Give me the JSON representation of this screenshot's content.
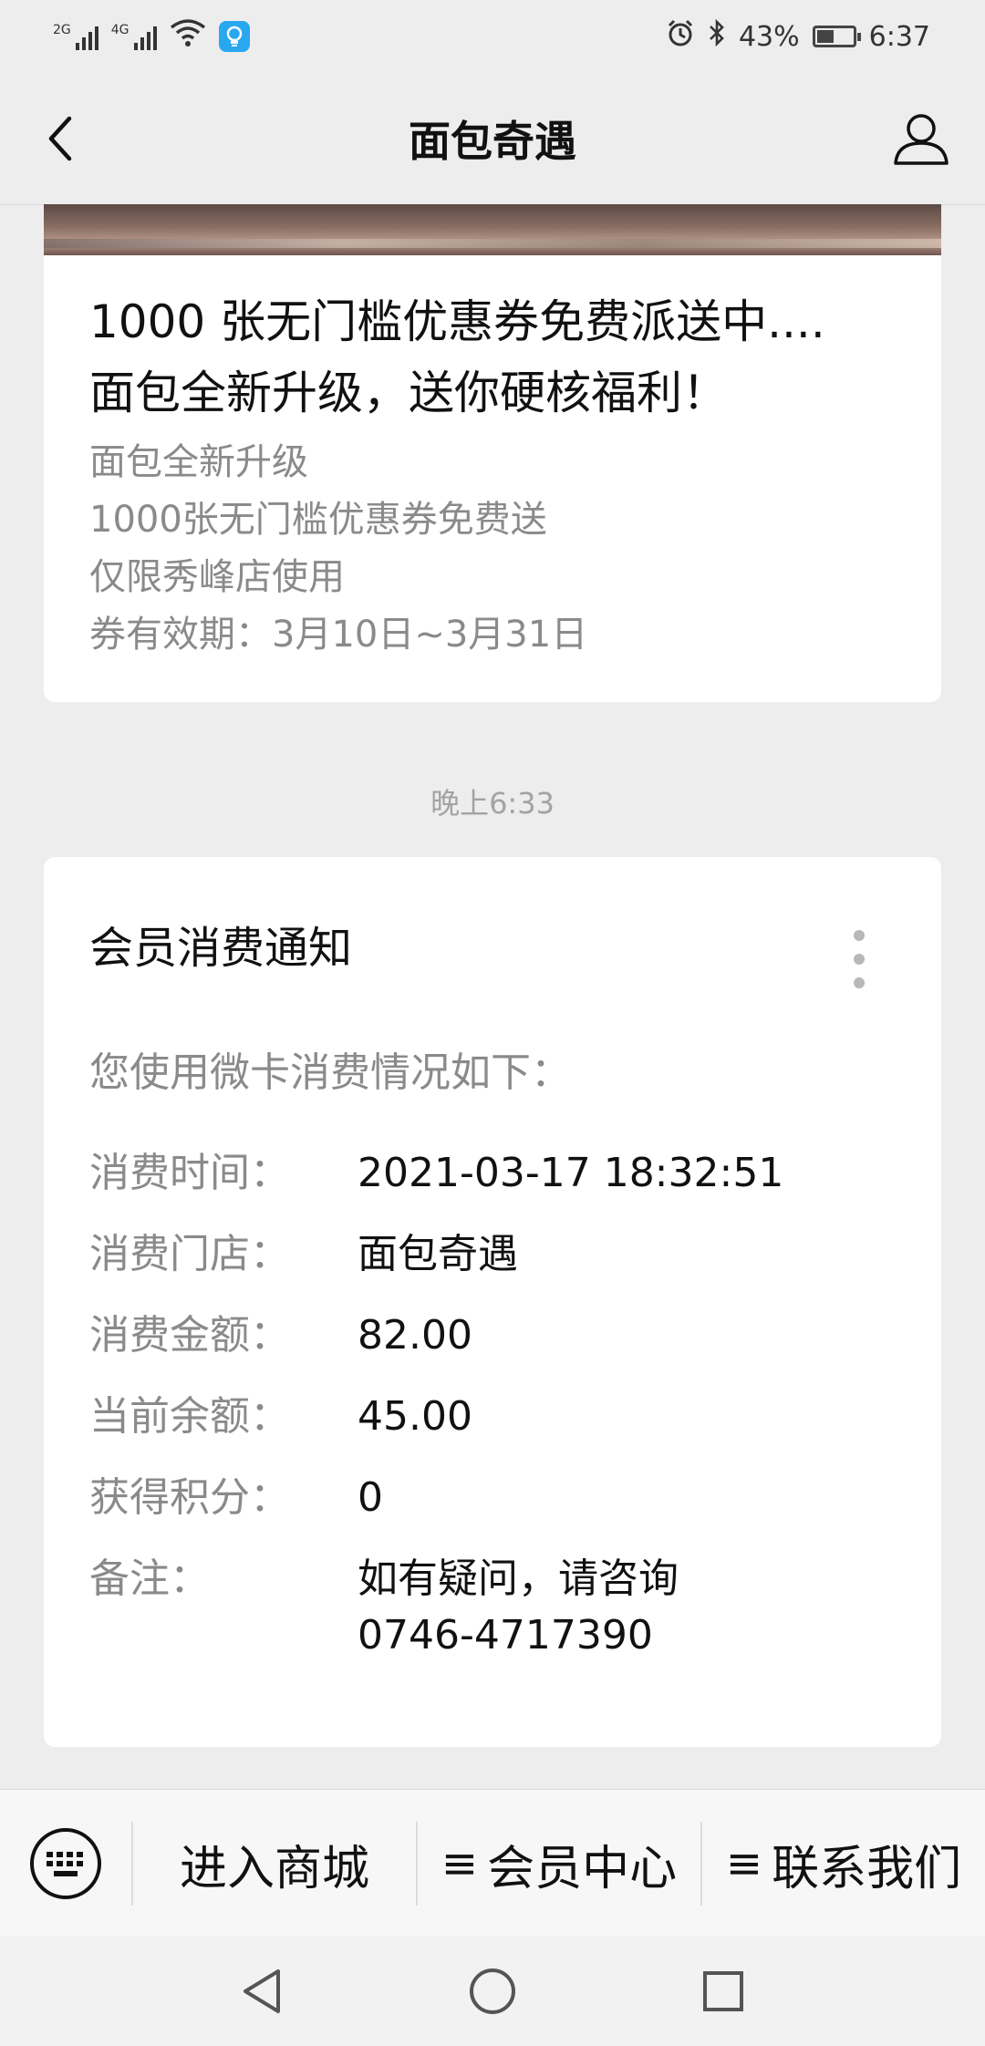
{
  "status_bar": {
    "signal1_tag": "2G",
    "signal2_tag": "4G",
    "battery": "43%",
    "time": "6:37"
  },
  "nav": {
    "title": "面包奇遇"
  },
  "article": {
    "title_line1": "1000 张无门槛优惠券免费派送中....",
    "title_line2": "面包全新升级，送你硬核福利！",
    "desc": [
      "面包全新升级",
      "1000张无门槛优惠券免费送",
      "仅限秀峰店使用",
      "券有效期：3月10日~3月31日"
    ]
  },
  "timestamp": "晚上6:33",
  "notice": {
    "title": "会员消费通知",
    "intro": "您使用微卡消费情况如下：",
    "rows": [
      {
        "label": "消费时间：",
        "value": "2021-03-17 18:32:51"
      },
      {
        "label": "消费门店：",
        "value": "面包奇遇"
      },
      {
        "label": "消费金额：",
        "value": "82.00"
      },
      {
        "label": "当前余额：",
        "value": "45.00"
      },
      {
        "label": "获得积分：",
        "value": "0"
      },
      {
        "label": "备注：",
        "value_line1": "如有疑问，请咨询",
        "value_line2": "0746-4717390"
      }
    ]
  },
  "menu": {
    "items": [
      {
        "label": "进入商城"
      },
      {
        "label": "会员中心"
      },
      {
        "label": "联系我们"
      }
    ]
  },
  "icons": {
    "back": "chevron-left-icon",
    "profile": "person-icon",
    "keyboard": "keyboard-icon",
    "more": "more-vertical-icon",
    "menu": "hamburger-icon"
  },
  "colors": {
    "background": "#ededed",
    "card": "#ffffff",
    "muted_text": "#8a8a8a",
    "bulb_icon": "#29a8f0"
  }
}
